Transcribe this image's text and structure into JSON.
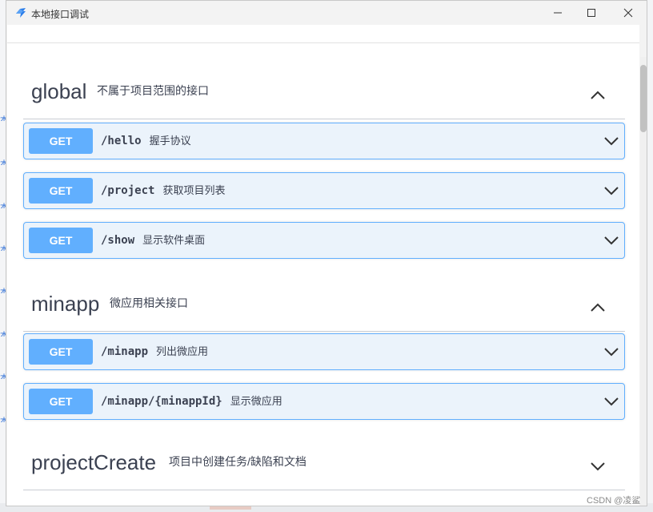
{
  "window": {
    "title": "本地接口调试"
  },
  "background": {
    "left_marks": [
      "本",
      "本",
      "本",
      "本",
      "本",
      "本",
      "本",
      "本"
    ]
  },
  "sections": [
    {
      "name": "global",
      "description": "不属于项目范围的接口",
      "expanded": true,
      "operations": [
        {
          "method": "GET",
          "path": "/hello",
          "summary": "握手协议"
        },
        {
          "method": "GET",
          "path": "/project",
          "summary": "获取项目列表"
        },
        {
          "method": "GET",
          "path": "/show",
          "summary": "显示软件桌面"
        }
      ]
    },
    {
      "name": "minapp",
      "description": "微应用相关接口",
      "expanded": true,
      "operations": [
        {
          "method": "GET",
          "path": "/minapp",
          "summary": "列出微应用"
        },
        {
          "method": "GET",
          "path": "/minapp/{minappId}",
          "summary": "显示微应用"
        }
      ]
    },
    {
      "name": "projectCreate",
      "description": "项目中创建任务/缺陷和文档",
      "expanded": false,
      "operations": []
    }
  ],
  "watermark": "CSDN @凌鲨",
  "colors": {
    "get_method": "#61affe",
    "op_background": "#ebf3fb",
    "text": "#3b4151"
  },
  "icons": {
    "app": "app-logo-icon",
    "minimize": "minimize-icon",
    "maximize": "maximize-icon",
    "close": "close-icon",
    "expanded": "chevron-up-icon",
    "collapsed": "chevron-down-icon"
  }
}
